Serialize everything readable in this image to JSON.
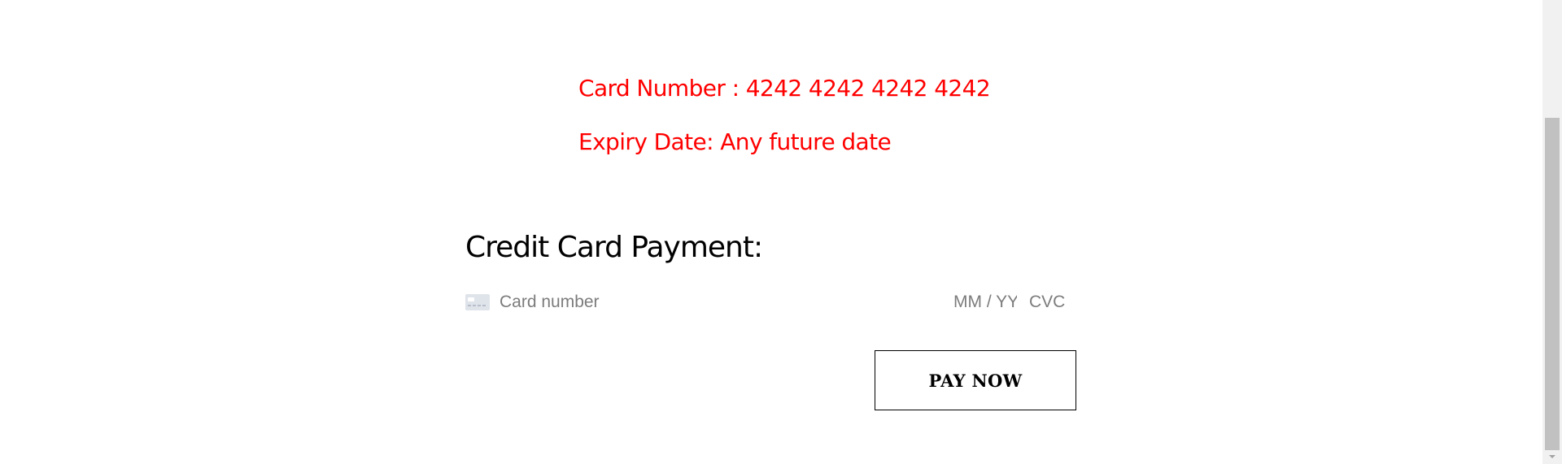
{
  "test_notes": {
    "card_number": "Card Number : 4242 4242 4242 4242",
    "expiry_date": "Expiry Date: Any future date"
  },
  "payment": {
    "heading": "Credit Card Payment:",
    "card_number_placeholder": "Card number",
    "expiry_placeholder": "MM / YY",
    "cvc_placeholder": "CVC",
    "card_icon": "credit-card-icon",
    "pay_button_label": "PAY NOW"
  },
  "colors": {
    "note_text": "#ff0000",
    "placeholder": "#7c7c7c",
    "button_border": "#000000",
    "scrollbar_track": "#f1f1f1",
    "scrollbar_thumb": "#c1c1c1"
  }
}
